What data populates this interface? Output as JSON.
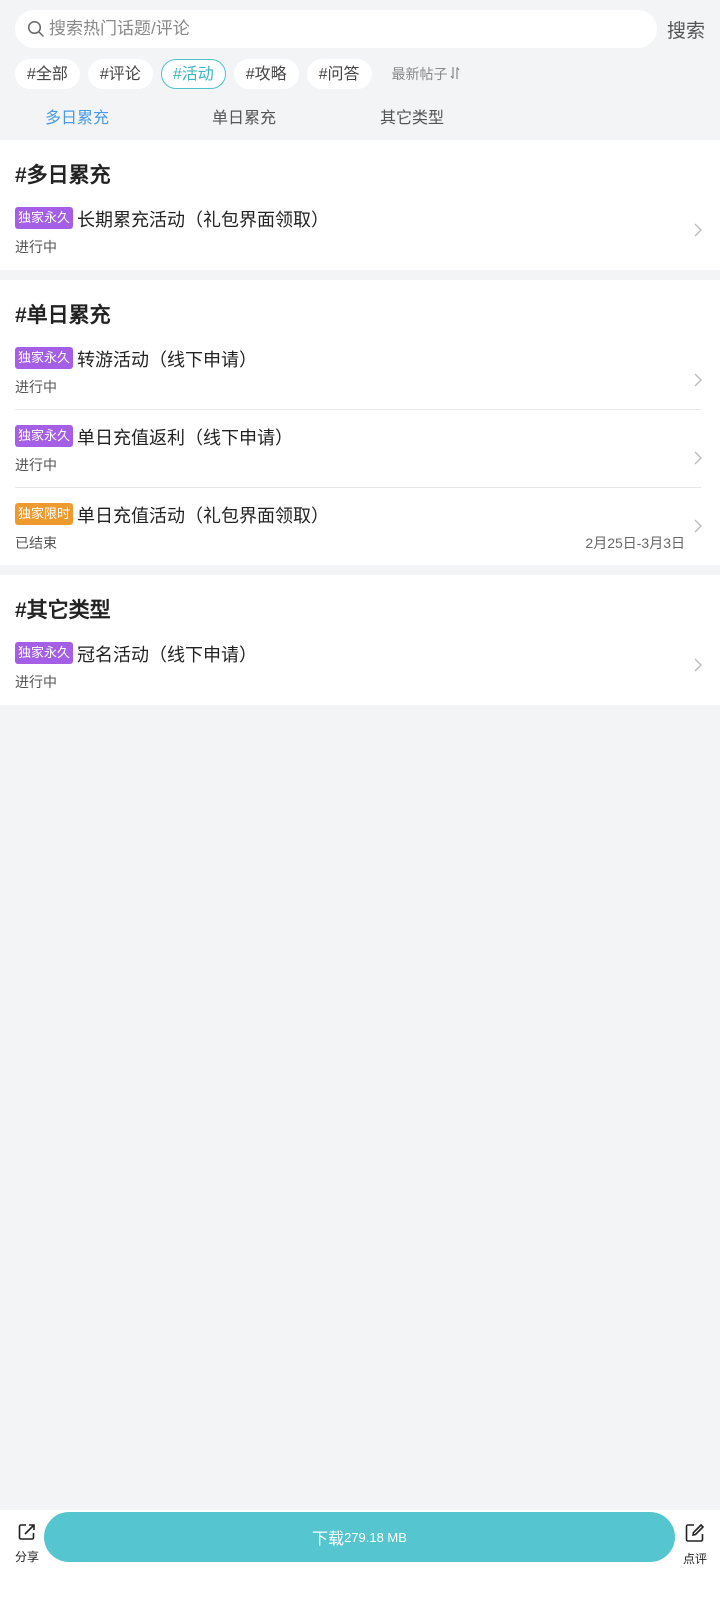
{
  "search": {
    "placeholder": "搜索热门话题/评论",
    "button_label": "搜索"
  },
  "filter_chips": [
    {
      "label": "#全部",
      "active": false
    },
    {
      "label": "#评论",
      "active": false
    },
    {
      "label": "#活动",
      "active": true
    },
    {
      "label": "#攻略",
      "active": false
    },
    {
      "label": "#问答",
      "active": false
    }
  ],
  "sort_label": "最新帖子",
  "tabs": [
    {
      "label": "多日累充",
      "active": true
    },
    {
      "label": "单日累充",
      "active": false
    },
    {
      "label": "其它类型",
      "active": false
    }
  ],
  "sections": [
    {
      "title": "#多日累充",
      "items": [
        {
          "badge": "独家永久",
          "badge_color": "#a55ee6",
          "title": "长期累充活动（礼包界面领取）",
          "status": "进行中",
          "date": ""
        }
      ]
    },
    {
      "title": "#单日累充",
      "items": [
        {
          "badge": "独家永久",
          "badge_color": "#a55ee6",
          "title": "转游活动（线下申请）",
          "status": "进行中",
          "date": ""
        },
        {
          "badge": "独家永久",
          "badge_color": "#a55ee6",
          "title": "单日充值返利（线下申请）",
          "status": "进行中",
          "date": ""
        },
        {
          "badge": "独家限时",
          "badge_color": "#ef9a2e",
          "title": "单日充值活动（礼包界面领取）",
          "status": "已结束",
          "date": "2月25日-3月3日"
        }
      ]
    },
    {
      "title": "#其它类型",
      "items": [
        {
          "badge": "独家永久",
          "badge_color": "#a55ee6",
          "title": "冠名活动（线下申请）",
          "status": "进行中",
          "date": ""
        }
      ]
    }
  ],
  "bottom": {
    "share_label": "分享",
    "download_label": "下载",
    "download_size": "279.18 MB",
    "review_label": "点评"
  },
  "colors": {
    "accent_teal": "#55c6cf",
    "active_tab_blue": "#4a9be6",
    "badge_purple": "#a55ee6",
    "badge_orange": "#ef9a2e"
  }
}
